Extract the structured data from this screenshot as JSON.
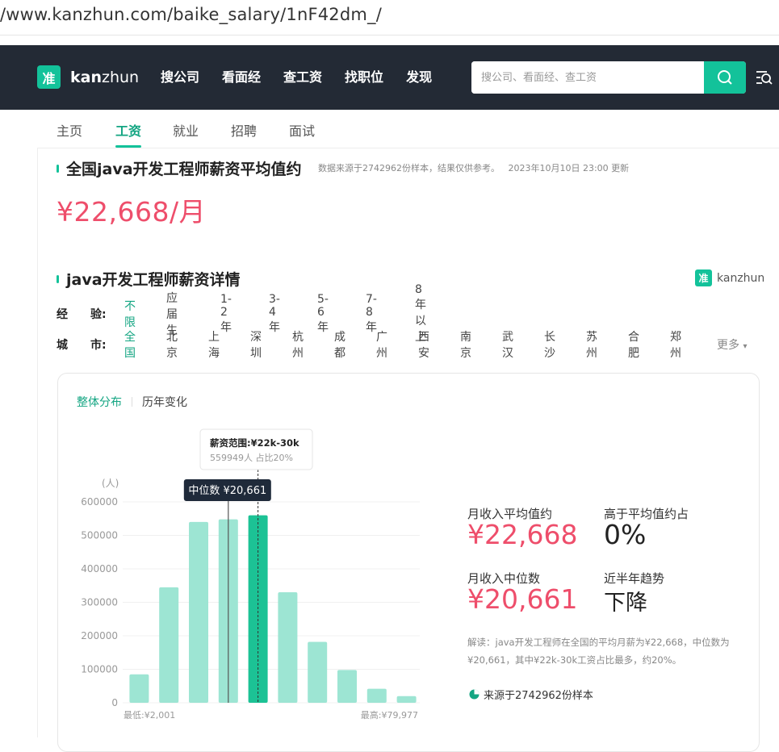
{
  "browser": {
    "url": "/www.kanzhun.com/baike_salary/1nF42dm_/"
  },
  "nav": {
    "logo_glyph": "准",
    "logo_text_bold": "kan",
    "logo_text_rest": "zhun",
    "links": [
      "搜公司",
      "看面经",
      "查工资",
      "找职位",
      "发现"
    ],
    "search_placeholder": "搜公司、看面经、查工资"
  },
  "tabs": {
    "items": [
      "主页",
      "工资",
      "就业",
      "招聘",
      "面试"
    ],
    "active": "工资"
  },
  "avg_section": {
    "title": "全国java开发工程师薪资平均值约",
    "meta": "数据来源于2742962份样本，结果仅供参考。   2023年10月10日 23:00 更新",
    "salary": "¥22,668/月"
  },
  "detail_section": {
    "title": "java开发工程师薪资详情",
    "brand_glyph": "准",
    "brand_text": "kanzhun"
  },
  "filters": {
    "experience_label": "经　　验:",
    "experience_options": [
      "不限",
      "应届生",
      "1-2年",
      "3-4年",
      "5-6年",
      "7-8年",
      "8年以上"
    ],
    "city_label": "城　　市:",
    "city_options": [
      "全国",
      "北京",
      "上海",
      "深圳",
      "杭州",
      "成都",
      "广州",
      "西安",
      "南京",
      "武汉",
      "长沙",
      "苏州",
      "合肥",
      "郑州"
    ],
    "more": "更多"
  },
  "subtabs": {
    "active": "整体分布",
    "other": "历年变化"
  },
  "chart_data": {
    "type": "bar",
    "ylabel": "(人)",
    "yticks": [
      0,
      100000,
      200000,
      300000,
      400000,
      500000,
      600000
    ],
    "ytick_labels": [
      "0",
      "100000",
      "200000",
      "300000",
      "400000",
      "500000",
      "600000"
    ],
    "ylim": [
      0,
      600000
    ],
    "values": [
      85000,
      345000,
      540000,
      548000,
      559949,
      330000,
      182000,
      98000,
      42000,
      20000
    ],
    "highlight_index": 4,
    "x_min_label": "最低:¥2,001",
    "x_max_label": "最高:¥79,977",
    "median_label": "中位数 ¥20,661",
    "tooltip_title": "薪资范围:¥22k-30k",
    "tooltip_body": "559949人 占比20%",
    "colors": {
      "bar": "#9de5d3",
      "highlight": "#1cc295",
      "median_line": "#555555"
    }
  },
  "stats": {
    "avg_label": "月收入平均值约",
    "avg_value": "¥22,668",
    "above_label": "高于平均值约占",
    "above_value": "0%",
    "median_label": "月收入中位数",
    "median_value": "¥20,661",
    "trend_label": "近半年趋势",
    "trend_value": "下降"
  },
  "explain": "解读：java开发工程师在全国的平均月薪为¥22,668，中位数为¥20,661，其中¥22k-30k工资占比最多，约20%。",
  "source": "来源于2742962份样本"
}
